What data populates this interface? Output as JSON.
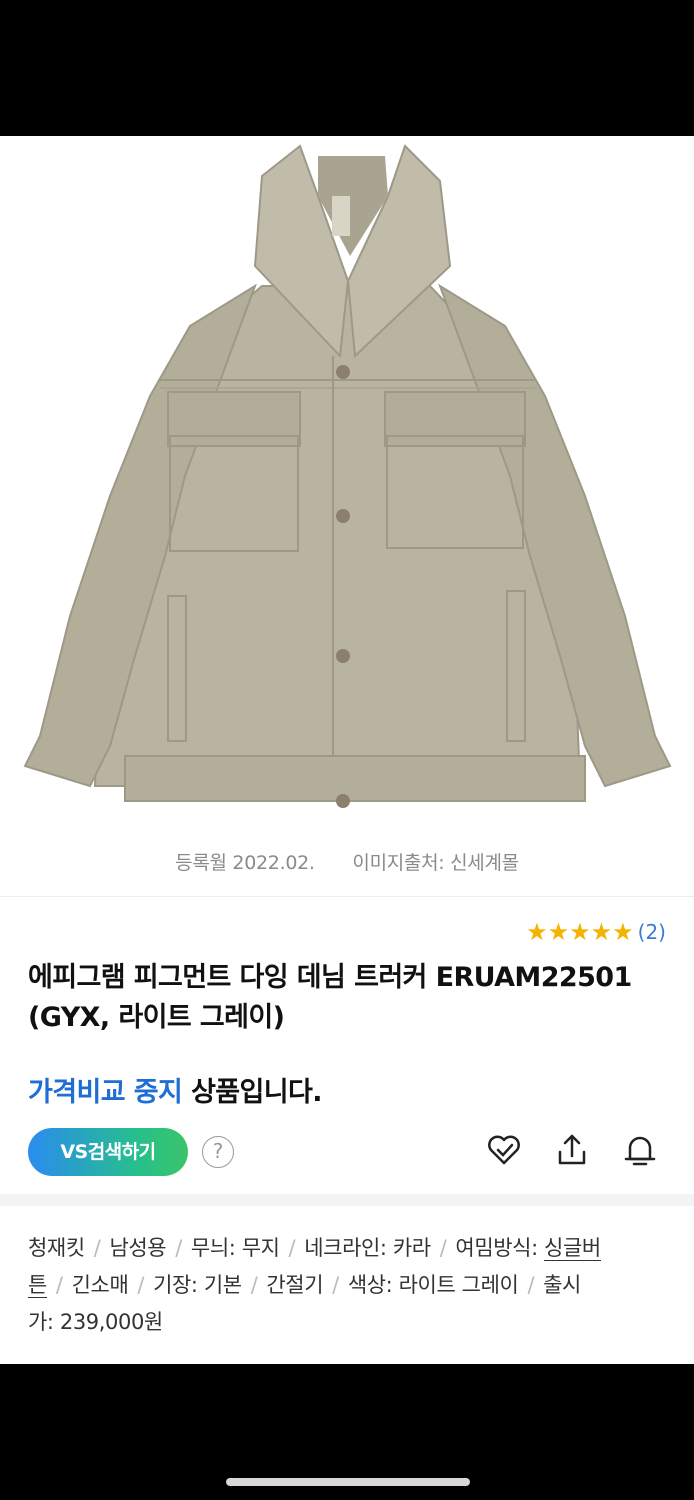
{
  "meta": {
    "registered": "등록월 2022.02.",
    "image_source": "이미지출처: 신세계몰"
  },
  "rating": {
    "stars": 5,
    "count": "(2)"
  },
  "product": {
    "title": "에피그램 피그먼트 다잉 데님 트러커 ERUAM22501 (GYX, 라이트 그레이)"
  },
  "compare": {
    "highlight": "가격비교 중지",
    "rest": "상품입니다."
  },
  "actions": {
    "vs_search": "VS검색하기",
    "help": "?"
  },
  "icons": [
    "heart-icon",
    "share-icon",
    "bell-icon"
  ],
  "specs": {
    "items": [
      "청재킷",
      "남성용",
      "무늬: 무지",
      "네크라인: 카라"
    ],
    "closure_label": "여밈방식: ",
    "closure_part1": "싱글버",
    "closure_part2": "튼",
    "items2": [
      "긴소매",
      "기장: 기본",
      "간절기",
      "색상: 라이트 그레이"
    ],
    "release_part1": "출시",
    "release_part2": "가: 239,000원"
  },
  "colors": {
    "accent_blue": "#1f6ed4",
    "star": "#f5b301",
    "jacket": "#b8b39f"
  }
}
